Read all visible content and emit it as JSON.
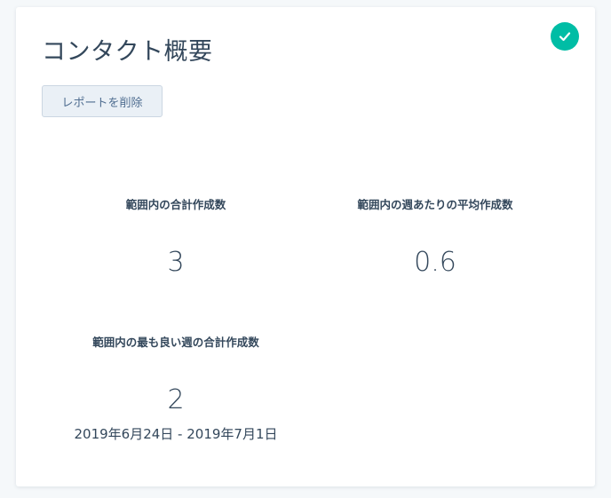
{
  "report": {
    "title": "コンタクト概要",
    "delete_button_label": "レポートを削除",
    "status_icon": "check-icon",
    "accent_color": "#00bda5"
  },
  "metrics": [
    {
      "label": "範囲内の合計作成数",
      "value": "3"
    },
    {
      "label": "範囲内の週あたりの平均作成数",
      "value": "0.6"
    },
    {
      "label": "範囲内の最も良い週の合計作成数",
      "value": "2",
      "range": "2019年6月24日 - 2019年7月1日"
    }
  ]
}
